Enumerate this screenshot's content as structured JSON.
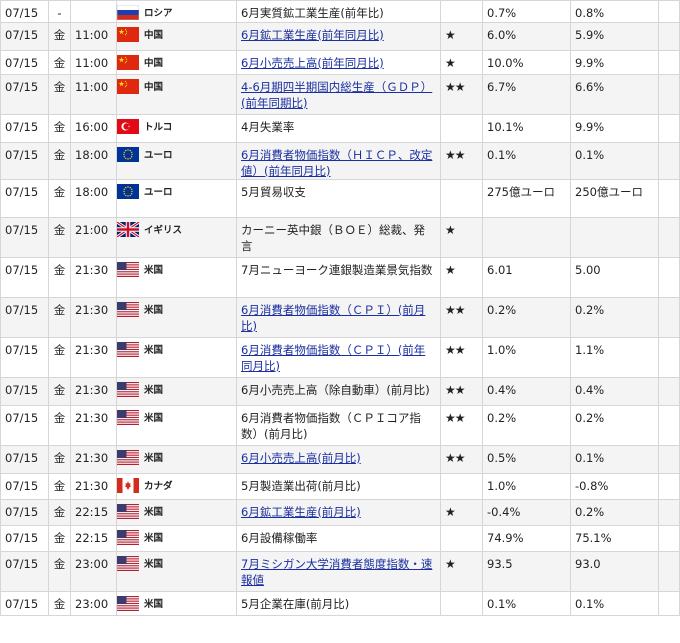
{
  "rows": [
    {
      "date": "07/15",
      "day": "-",
      "time": "",
      "flag": "russia",
      "country": "ロシア",
      "event": "6月実質鉱工業生産(前年比)",
      "link": false,
      "importance": "",
      "previous": "0.7%",
      "forecast": "0.8%",
      "result": ""
    },
    {
      "date": "07/15",
      "day": "金",
      "time": "11:00",
      "flag": "china",
      "country": "中国",
      "event": "6月鉱工業生産(前年同月比)",
      "link": true,
      "importance": "★",
      "previous": "6.0%",
      "forecast": "5.9%",
      "result": ""
    },
    {
      "date": "07/15",
      "day": "金",
      "time": "11:00",
      "flag": "china",
      "country": "中国",
      "event": "6月小売売上高(前年同月比)",
      "link": true,
      "importance": "★",
      "previous": "10.0%",
      "forecast": "9.9%",
      "result": ""
    },
    {
      "date": "07/15",
      "day": "金",
      "time": "11:00",
      "flag": "china",
      "country": "中国",
      "event": "4-6月期四半期国内総生産（ＧＤＰ）(前年同期比)",
      "link": true,
      "importance": "★★",
      "previous": "6.7%",
      "forecast": "6.6%",
      "result": ""
    },
    {
      "date": "07/15",
      "day": "金",
      "time": "16:00",
      "flag": "turkey",
      "country": "トルコ",
      "event": "4月失業率",
      "link": false,
      "importance": "",
      "previous": "10.1%",
      "forecast": "9.9%",
      "result": ""
    },
    {
      "date": "07/15",
      "day": "金",
      "time": "18:00",
      "flag": "eu",
      "country": "ユーロ",
      "event": "6月消費者物価指数（ＨＩＣＰ、改定値）(前年同月比)",
      "link": true,
      "importance": "★★",
      "previous": "0.1%",
      "forecast": "0.1%",
      "result": ""
    },
    {
      "date": "07/15",
      "day": "金",
      "time": "18:00",
      "flag": "eu",
      "country": "ユーロ",
      "event": "5月貿易収支",
      "link": false,
      "importance": "",
      "previous": "275億ユーロ",
      "forecast": "250億ユーロ",
      "result": ""
    },
    {
      "date": "07/15",
      "day": "金",
      "time": "21:00",
      "flag": "uk",
      "country": "イギリス",
      "event": " カーニー英中銀（ＢＯＥ）総裁、発言",
      "link": false,
      "importance": "★",
      "previous": "",
      "forecast": "",
      "result": ""
    },
    {
      "date": "07/15",
      "day": "金",
      "time": "21:30",
      "flag": "us",
      "country": "米国",
      "event": "7月ニューヨーク連銀製造業景気指数",
      "link": false,
      "importance": "★",
      "previous": "6.01",
      "forecast": "5.00",
      "result": ""
    },
    {
      "date": "07/15",
      "day": "金",
      "time": "21:30",
      "flag": "us",
      "country": "米国",
      "event": "6月消費者物価指数（ＣＰＩ）(前月比)",
      "link": true,
      "importance": "★★",
      "previous": "0.2%",
      "forecast": "0.2%",
      "result": ""
    },
    {
      "date": "07/15",
      "day": "金",
      "time": "21:30",
      "flag": "us",
      "country": "米国",
      "event": "6月消費者物価指数（ＣＰＩ）(前年同月比)",
      "link": true,
      "importance": "★★",
      "previous": "1.0%",
      "forecast": "1.1%",
      "result": ""
    },
    {
      "date": "07/15",
      "day": "金",
      "time": "21:30",
      "flag": "us",
      "country": "米国",
      "event": "6月小売売上高（除自動車）(前月比)",
      "link": false,
      "importance": "★★",
      "previous": "0.4%",
      "forecast": "0.4%",
      "result": ""
    },
    {
      "date": "07/15",
      "day": "金",
      "time": "21:30",
      "flag": "us",
      "country": "米国",
      "event": "6月消費者物価指数（ＣＰＩコア指数）(前月比)",
      "link": false,
      "importance": "★★",
      "previous": "0.2%",
      "forecast": "0.2%",
      "result": ""
    },
    {
      "date": "07/15",
      "day": "金",
      "time": "21:30",
      "flag": "us",
      "country": "米国",
      "event": "6月小売売上高(前月比)",
      "link": true,
      "importance": "★★",
      "previous": "0.5%",
      "forecast": "0.1%",
      "result": ""
    },
    {
      "date": "07/15",
      "day": "金",
      "time": "21:30",
      "flag": "canada",
      "country": "カナダ",
      "event": "5月製造業出荷(前月比)",
      "link": false,
      "importance": "",
      "previous": "1.0%",
      "forecast": "-0.8%",
      "result": ""
    },
    {
      "date": "07/15",
      "day": "金",
      "time": "22:15",
      "flag": "us",
      "country": "米国",
      "event": "6月鉱工業生産(前月比)",
      "link": true,
      "importance": "★",
      "previous": "-0.4%",
      "forecast": "0.2%",
      "result": ""
    },
    {
      "date": "07/15",
      "day": "金",
      "time": "22:15",
      "flag": "us",
      "country": "米国",
      "event": "6月設備稼働率",
      "link": false,
      "importance": "",
      "previous": "74.9%",
      "forecast": "75.1%",
      "result": ""
    },
    {
      "date": "07/15",
      "day": "金",
      "time": "23:00",
      "flag": "us",
      "country": "米国",
      "event": "7月ミシガン大学消費者態度指数・速報値",
      "link": true,
      "importance": "★",
      "previous": "93.5",
      "forecast": "93.0",
      "result": ""
    },
    {
      "date": "07/15",
      "day": "金",
      "time": "23:00",
      "flag": "us",
      "country": "米国",
      "event": "5月企業在庫(前月比)",
      "link": false,
      "importance": "",
      "previous": "0.1%",
      "forecast": "0.1%",
      "result": ""
    }
  ],
  "colors": {
    "link": "#1a2fa0",
    "border": "#d6d6d6",
    "alt_row": "#f4f4f4"
  }
}
